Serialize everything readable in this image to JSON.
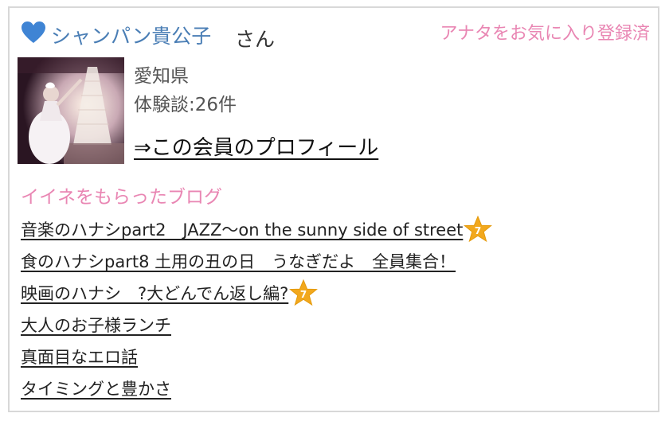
{
  "header": {
    "member_name": "シャンパン貴公子",
    "honorific": "さん",
    "favorite_status": "アナタをお気に入り登録済",
    "heart_color": "#3f84d4"
  },
  "profile": {
    "prefecture": "愛知県",
    "experience_count": "体験談:26件",
    "profile_link": "⇒この会員のプロフィール"
  },
  "liked_blogs": {
    "title": "イイネをもらったブログ",
    "items": [
      {
        "label": "音楽のハナシpart2　JAZZ～on the sunny side of street",
        "badge": "7"
      },
      {
        "label": "食のハナシpart8 土用の丑の日　うなぎだよ　全員集合！",
        "badge": ""
      },
      {
        "label": "映画のハナシ　?大どんでん返し編?",
        "badge": "7"
      },
      {
        "label": "大人のお子様ランチ",
        "badge": ""
      },
      {
        "label": "真面目なエロ話",
        "badge": ""
      },
      {
        "label": "タイミングと豊かさ",
        "badge": ""
      }
    ]
  },
  "colors": {
    "accent_pink": "#e986b3",
    "link_blue": "#4a7eb5",
    "star_orange": "#f2a81d"
  }
}
